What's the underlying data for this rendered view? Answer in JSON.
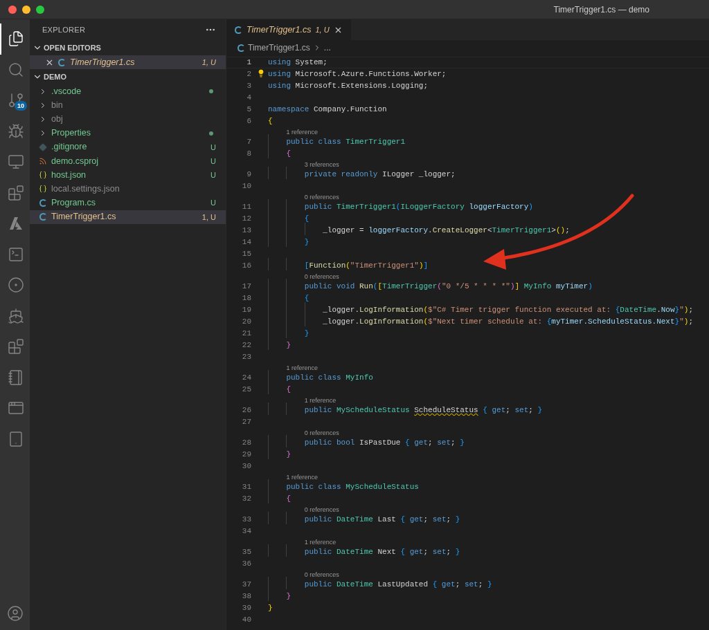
{
  "window": {
    "title": "TimerTrigger1.cs — demo"
  },
  "activity_bar": {
    "items": [
      {
        "selected": true
      },
      {
        "selected": false
      },
      {
        "selected": false,
        "badge": "10"
      },
      {
        "selected": false
      },
      {
        "selected": false
      },
      {
        "selected": false
      },
      {
        "selected": false
      },
      {
        "selected": false
      },
      {
        "selected": false
      },
      {
        "selected": false
      },
      {
        "selected": false
      },
      {
        "selected": false
      },
      {
        "selected": false
      },
      {
        "selected": false
      }
    ]
  },
  "sidebar": {
    "title": "EXPLORER",
    "open_editors": {
      "title": "OPEN EDITORS",
      "expanded": true,
      "items": [
        {
          "name": "TimerTrigger1.cs",
          "status": "1, U",
          "color": "#e2c08d",
          "selected": true
        }
      ]
    },
    "folder": {
      "title": "DEMO",
      "expanded": true,
      "items": [
        {
          "kind": "folder",
          "name": ".vscode",
          "color": "#73c991",
          "expanded": false,
          "changes_dot": true,
          "selected": false
        },
        {
          "kind": "folder",
          "name": "bin",
          "color": "#8c8c8c",
          "expanded": false,
          "changes_dot": false,
          "selected": false
        },
        {
          "kind": "folder",
          "name": "obj",
          "color": "#8c8c8c",
          "expanded": false,
          "changes_dot": false,
          "selected": false
        },
        {
          "kind": "folder",
          "name": "Properties",
          "color": "#73c991",
          "expanded": false,
          "changes_dot": true,
          "selected": false
        },
        {
          "kind": "git",
          "name": ".gitignore",
          "color": "#73c991",
          "status": "U",
          "selected": false
        },
        {
          "kind": "feed",
          "name": "demo.csproj",
          "color": "#73c991",
          "status": "U",
          "selected": false
        },
        {
          "kind": "json",
          "name": "host.json",
          "color": "#73c991",
          "status": "U",
          "selected": false
        },
        {
          "kind": "json",
          "name": "local.settings.json",
          "color": "#8c8c8c",
          "selected": false
        },
        {
          "kind": "csharp",
          "name": "Program.cs",
          "color": "#73c991",
          "status": "U",
          "selected": false
        },
        {
          "kind": "csharp",
          "name": "TimerTrigger1.cs",
          "color": "#e2c08d",
          "status": "1, U",
          "selected": true
        }
      ]
    }
  },
  "tabs": [
    {
      "label": "TimerTrigger1.cs",
      "status": "1, U",
      "selected": true
    }
  ],
  "breadcrumb": [
    "TimerTrigger1.cs",
    "..."
  ],
  "code": [
    {
      "number": "1",
      "current": true,
      "tokens": [
        {
          "text": "using",
          "kind": "k"
        },
        {
          "text": " System;",
          "kind": "p"
        }
      ]
    },
    {
      "number": "2",
      "current": false,
      "lightbulb": true,
      "tokens": [
        {
          "text": "using",
          "kind": "k"
        },
        {
          "text": " Microsoft.Azure.Functions.Worker;",
          "kind": "p"
        }
      ]
    },
    {
      "number": "3",
      "current": false,
      "tokens": [
        {
          "text": "using",
          "kind": "k"
        },
        {
          "text": " Microsoft.Extensions.Logging;",
          "kind": "p"
        }
      ]
    },
    {
      "number": "4",
      "current": false
    },
    {
      "number": "5",
      "current": false,
      "tokens": [
        {
          "text": "namespace",
          "kind": "k"
        },
        {
          "text": " Company.Function",
          "kind": "p"
        }
      ]
    },
    {
      "number": "6",
      "current": false,
      "tokens": [
        {
          "text": "{",
          "kind": "y"
        }
      ]
    },
    {
      "number": "7",
      "current": false,
      "lens": "1 reference",
      "tokens": [
        {
          "text": "    public class",
          "kind": "k"
        },
        {
          "text": " TimerTrigger1",
          "kind": "t"
        }
      ]
    },
    {
      "number": "8",
      "current": false,
      "tokens": [
        {
          "text": "    {",
          "kind": "pk"
        }
      ]
    },
    {
      "number": "9",
      "current": false,
      "lens": "3 references",
      "tokens": [
        {
          "text": "        private readonly",
          "kind": "k"
        },
        {
          "text": " ILogger _logger;",
          "kind": "p"
        }
      ]
    },
    {
      "number": "10",
      "current": false
    },
    {
      "number": "11",
      "current": false,
      "lens": "0 references",
      "tokens": [
        {
          "text": "        public",
          "kind": "k"
        },
        {
          "text": " TimerTrigger1",
          "kind": "t"
        },
        {
          "text": "(",
          "kind": "b"
        },
        {
          "text": "ILoggerFactory",
          "kind": "t"
        },
        {
          "text": " loggerFactory",
          "kind": "v"
        },
        {
          "text": ")",
          "kind": "b"
        }
      ]
    },
    {
      "number": "12",
      "current": false,
      "tokens": [
        {
          "text": "        {",
          "kind": "b"
        }
      ]
    },
    {
      "number": "13",
      "current": false,
      "tokens": [
        {
          "text": "            _logger = ",
          "kind": "p"
        },
        {
          "text": "loggerFactory",
          "kind": "v"
        },
        {
          "text": ".",
          "kind": "p"
        },
        {
          "text": "CreateLogger",
          "kind": "m"
        },
        {
          "text": "<",
          "kind": "p"
        },
        {
          "text": "TimerTrigger1",
          "kind": "t"
        },
        {
          "text": ">",
          "kind": "p"
        },
        {
          "text": "()",
          "kind": "y"
        },
        {
          "text": ";",
          "kind": "p"
        }
      ]
    },
    {
      "number": "14",
      "current": false,
      "tokens": [
        {
          "text": "        }",
          "kind": "b"
        }
      ]
    },
    {
      "number": "15",
      "current": false
    },
    {
      "number": "16",
      "current": false,
      "tokens": [
        {
          "text": "        [",
          "kind": "b"
        },
        {
          "text": "Function",
          "kind": "m"
        },
        {
          "text": "(",
          "kind": "y"
        },
        {
          "text": "\"TimerTrigger1\"",
          "kind": "s"
        },
        {
          "text": ")",
          "kind": "y"
        },
        {
          "text": "]",
          "kind": "b"
        }
      ]
    },
    {
      "number": "17",
      "current": false,
      "lens": "0 references",
      "tokens": [
        {
          "text": "        public void",
          "kind": "k"
        },
        {
          "text": " Run",
          "kind": "m"
        },
        {
          "text": "(",
          "kind": "b"
        },
        {
          "text": "[",
          "kind": "y"
        },
        {
          "text": "TimerTrigger",
          "kind": "t"
        },
        {
          "text": "(",
          "kind": "pk"
        },
        {
          "text": "\"0 */5 * * * *\"",
          "kind": "s"
        },
        {
          "text": ")",
          "kind": "pk"
        },
        {
          "text": "]",
          "kind": "y"
        },
        {
          "text": " MyInfo",
          "kind": "t"
        },
        {
          "text": " myTimer",
          "kind": "v"
        },
        {
          "text": ")",
          "kind": "b"
        }
      ]
    },
    {
      "number": "18",
      "current": false,
      "tokens": [
        {
          "text": "        {",
          "kind": "b"
        }
      ]
    },
    {
      "number": "19",
      "current": false,
      "tokens": [
        {
          "text": "            _logger.",
          "kind": "p"
        },
        {
          "text": "LogInformation",
          "kind": "m"
        },
        {
          "text": "(",
          "kind": "y"
        },
        {
          "text": "$\"C# Timer trigger function executed at: ",
          "kind": "s"
        },
        {
          "text": "{",
          "kind": "b"
        },
        {
          "text": "DateTime",
          "kind": "t"
        },
        {
          "text": ".",
          "kind": "p"
        },
        {
          "text": "Now",
          "kind": "v"
        },
        {
          "text": "}",
          "kind": "b"
        },
        {
          "text": "\"",
          "kind": "s"
        },
        {
          "text": ")",
          "kind": "y"
        },
        {
          "text": ";",
          "kind": "p"
        }
      ]
    },
    {
      "number": "20",
      "current": false,
      "tokens": [
        {
          "text": "            _logger.",
          "kind": "p"
        },
        {
          "text": "LogInformation",
          "kind": "m"
        },
        {
          "text": "(",
          "kind": "y"
        },
        {
          "text": "$\"Next timer schedule at: ",
          "kind": "s"
        },
        {
          "text": "{",
          "kind": "b"
        },
        {
          "text": "myTimer.ScheduleStatus.Next",
          "kind": "v"
        },
        {
          "text": "}",
          "kind": "b"
        },
        {
          "text": "\"",
          "kind": "s"
        },
        {
          "text": ")",
          "kind": "y"
        },
        {
          "text": ";",
          "kind": "p"
        }
      ]
    },
    {
      "number": "21",
      "current": false,
      "tokens": [
        {
          "text": "        }",
          "kind": "b"
        }
      ]
    },
    {
      "number": "22",
      "current": false,
      "tokens": [
        {
          "text": "    }",
          "kind": "pk"
        }
      ]
    },
    {
      "number": "23",
      "current": false
    },
    {
      "number": "24",
      "current": false,
      "lens": "1 reference",
      "tokens": [
        {
          "text": "    public class",
          "kind": "k"
        },
        {
          "text": " MyInfo",
          "kind": "t"
        }
      ]
    },
    {
      "number": "25",
      "current": false,
      "tokens": [
        {
          "text": "    {",
          "kind": "pk"
        }
      ]
    },
    {
      "number": "26",
      "current": false,
      "lens": "1 reference",
      "tokens": [
        {
          "text": "        public",
          "kind": "k"
        },
        {
          "text": " MyScheduleStatus ",
          "kind": "t"
        },
        {
          "text": "ScheduleStatus",
          "kind": "w"
        },
        {
          "text": " {",
          "kind": "b"
        },
        {
          "text": " get",
          "kind": "k"
        },
        {
          "text": ";",
          "kind": "p"
        },
        {
          "text": " set",
          "kind": "k"
        },
        {
          "text": ";",
          "kind": "p"
        },
        {
          "text": " }",
          "kind": "b"
        }
      ]
    },
    {
      "number": "27",
      "current": false
    },
    {
      "number": "28",
      "current": false,
      "lens": "0 references",
      "tokens": [
        {
          "text": "        public bool",
          "kind": "k"
        },
        {
          "text": " IsPastDue",
          "kind": "p"
        },
        {
          "text": " {",
          "kind": "b"
        },
        {
          "text": " get",
          "kind": "k"
        },
        {
          "text": ";",
          "kind": "p"
        },
        {
          "text": " set",
          "kind": "k"
        },
        {
          "text": ";",
          "kind": "p"
        },
        {
          "text": " }",
          "kind": "b"
        }
      ]
    },
    {
      "number": "29",
      "current": false,
      "tokens": [
        {
          "text": "    }",
          "kind": "pk"
        }
      ]
    },
    {
      "number": "30",
      "current": false
    },
    {
      "number": "31",
      "current": false,
      "lens": "1 reference",
      "tokens": [
        {
          "text": "    public class",
          "kind": "k"
        },
        {
          "text": " MyScheduleStatus",
          "kind": "t"
        }
      ]
    },
    {
      "number": "32",
      "current": false,
      "tokens": [
        {
          "text": "    {",
          "kind": "pk"
        }
      ]
    },
    {
      "number": "33",
      "current": false,
      "lens": "0 references",
      "tokens": [
        {
          "text": "        public",
          "kind": "k"
        },
        {
          "text": " DateTime",
          "kind": "t"
        },
        {
          "text": " Last",
          "kind": "p"
        },
        {
          "text": " {",
          "kind": "b"
        },
        {
          "text": " get",
          "kind": "k"
        },
        {
          "text": ";",
          "kind": "p"
        },
        {
          "text": " set",
          "kind": "k"
        },
        {
          "text": ";",
          "kind": "p"
        },
        {
          "text": " }",
          "kind": "b"
        }
      ]
    },
    {
      "number": "34",
      "current": false
    },
    {
      "number": "35",
      "current": false,
      "lens": "1 reference",
      "tokens": [
        {
          "text": "        public",
          "kind": "k"
        },
        {
          "text": " DateTime",
          "kind": "t"
        },
        {
          "text": " Next",
          "kind": "p"
        },
        {
          "text": " {",
          "kind": "b"
        },
        {
          "text": " get",
          "kind": "k"
        },
        {
          "text": ";",
          "kind": "p"
        },
        {
          "text": " set",
          "kind": "k"
        },
        {
          "text": ";",
          "kind": "p"
        },
        {
          "text": " }",
          "kind": "b"
        }
      ]
    },
    {
      "number": "36",
      "current": false
    },
    {
      "number": "37",
      "current": false,
      "lens": "0 references",
      "tokens": [
        {
          "text": "        public",
          "kind": "k"
        },
        {
          "text": " DateTime",
          "kind": "t"
        },
        {
          "text": " LastUpdated",
          "kind": "p"
        },
        {
          "text": " {",
          "kind": "b"
        },
        {
          "text": " get",
          "kind": "k"
        },
        {
          "text": ";",
          "kind": "p"
        },
        {
          "text": " set",
          "kind": "k"
        },
        {
          "text": ";",
          "kind": "p"
        },
        {
          "text": " }",
          "kind": "b"
        }
      ]
    },
    {
      "number": "38",
      "current": false,
      "tokens": [
        {
          "text": "    }",
          "kind": "pk"
        }
      ]
    },
    {
      "number": "39",
      "current": false,
      "tokens": [
        {
          "text": "}",
          "kind": "y"
        }
      ]
    },
    {
      "number": "40",
      "current": false
    }
  ]
}
